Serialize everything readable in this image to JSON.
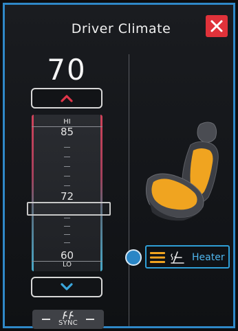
{
  "header": {
    "title": "Driver Climate",
    "close_icon": "close-icon"
  },
  "temperature": {
    "current": "70",
    "up_icon": "chevron-up-icon",
    "down_icon": "chevron-down-icon",
    "scale": {
      "hi_label": "HI",
      "top_value": "85",
      "mid_value": "72",
      "bottom_value": "60",
      "lo_label": "LO"
    }
  },
  "sync": {
    "label": "SYNC",
    "icon": "sync-seats-icon"
  },
  "seat": {
    "icon": "seat-heat-illustration",
    "highlight_color": "#f0a420"
  },
  "heater": {
    "label": "Heater",
    "icon": "seat-heater-icon",
    "level_icon": "level-bars-icon"
  },
  "colors": {
    "accent": "#2f88c8",
    "close": "#e0323a",
    "heat": "#f0a420",
    "up_arrow": "#e0364a",
    "down_arrow": "#3aa6dc"
  }
}
